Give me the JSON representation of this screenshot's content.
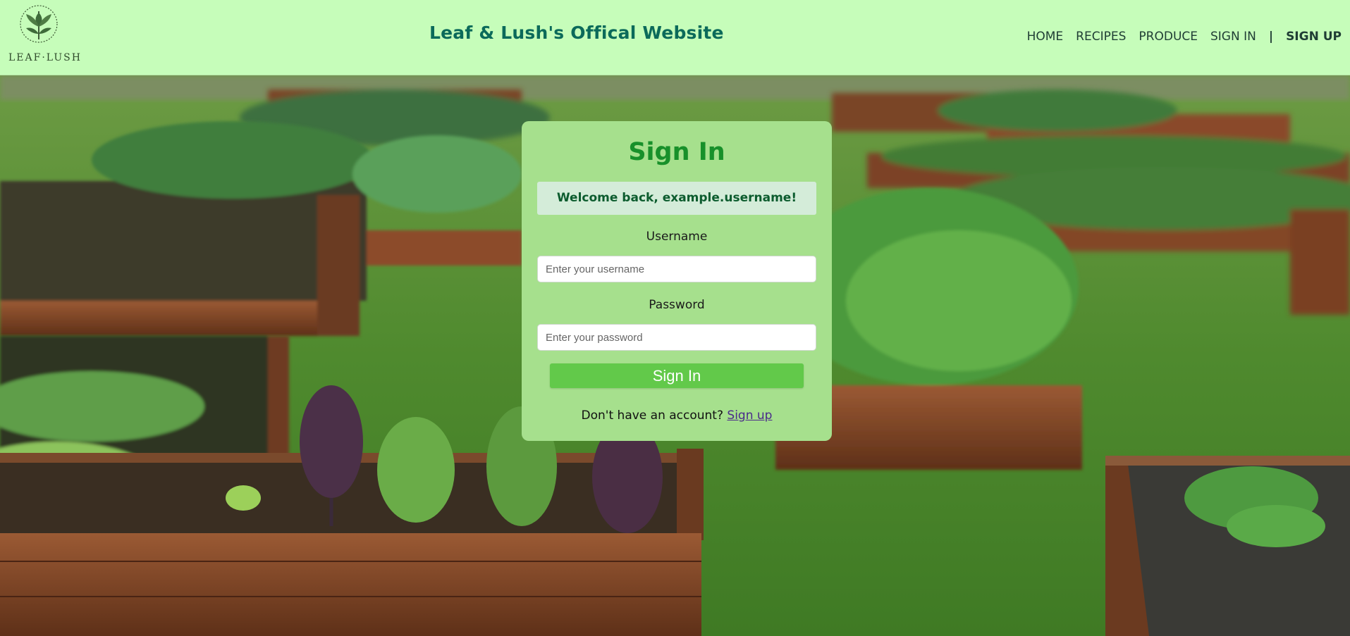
{
  "header": {
    "logo_text": "LEAF·LUSH",
    "site_title": "Leaf & Lush's Offical Website",
    "nav": [
      {
        "label": "HOME"
      },
      {
        "label": "RECIPES"
      },
      {
        "label": "PRODUCE"
      },
      {
        "label": "SIGN IN"
      }
    ],
    "separator": "|",
    "signup_label": "SIGN UP"
  },
  "signin": {
    "title": "Sign In",
    "welcome": "Welcome back, example.username!",
    "username_label": "Username",
    "username_placeholder": "Enter your username",
    "password_label": "Password",
    "password_placeholder": "Enter your password",
    "submit_label": "Sign In",
    "footer_text": "Don't have an account? ",
    "footer_link": "Sign up"
  },
  "colors": {
    "header_bg": "#c6fdba",
    "title_color": "#0b6a5a",
    "card_bg": "#a6e08d",
    "card_title": "#18902a",
    "button_bg": "#62c94a",
    "welcome_bg": "#d4ecd9"
  }
}
